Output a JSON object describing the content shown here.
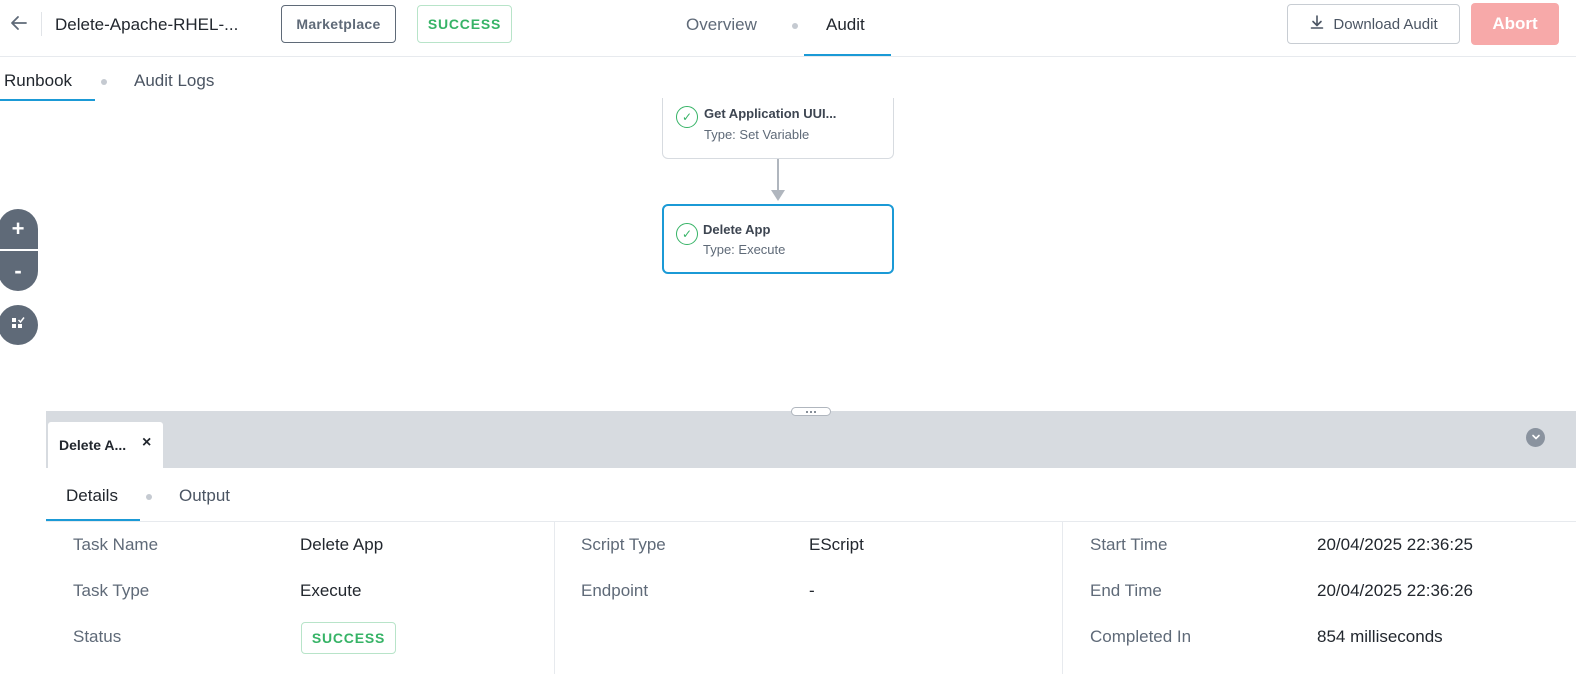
{
  "header": {
    "title": "Delete-Apache-RHEL-...",
    "source_tag": "Marketplace",
    "status_tag": "SUCCESS",
    "tabs": [
      {
        "label": "Overview"
      },
      {
        "label": "Audit"
      }
    ],
    "download_label": "Download Audit",
    "abort_label": "Abort"
  },
  "subtabs": [
    {
      "label": "Runbook"
    },
    {
      "label": "Audit Logs"
    }
  ],
  "canvas": {
    "nodes": [
      {
        "title": "Get Application UUI...",
        "type": "Type: Set Variable"
      },
      {
        "title": "Delete App",
        "type": "Type: Execute"
      }
    ],
    "zoom_in": "+",
    "zoom_out": "-"
  },
  "panel": {
    "tab_label": "Delete A...",
    "tab_close": "×",
    "detail_tabs": [
      {
        "label": "Details"
      },
      {
        "label": "Output"
      }
    ],
    "details": {
      "task_name_label": "Task Name",
      "task_name": "Delete App",
      "task_type_label": "Task Type",
      "task_type": "Execute",
      "status_label": "Status",
      "status": "SUCCESS",
      "script_type_label": "Script Type",
      "script_type": "EScript",
      "endpoint_label": "Endpoint",
      "endpoint": "-",
      "start_time_label": "Start Time",
      "start_time": "20/04/2025 22:36:25",
      "end_time_label": "End Time",
      "end_time": "20/04/2025 22:36:26",
      "completed_in_label": "Completed In",
      "completed_in": "854 milliseconds"
    }
  },
  "colors": {
    "accent": "#1b9ad6",
    "success": "#36b366",
    "abort_disabled": "#f7a9a9",
    "panel_bar": "#d7dbe0",
    "zoom_control": "#5f6a78"
  },
  "icons": {
    "back": "arrow-left-icon",
    "download": "download-icon",
    "check": "check-circle-icon",
    "fit": "fit-to-screen-icon",
    "collapse": "chevron-down-icon"
  }
}
